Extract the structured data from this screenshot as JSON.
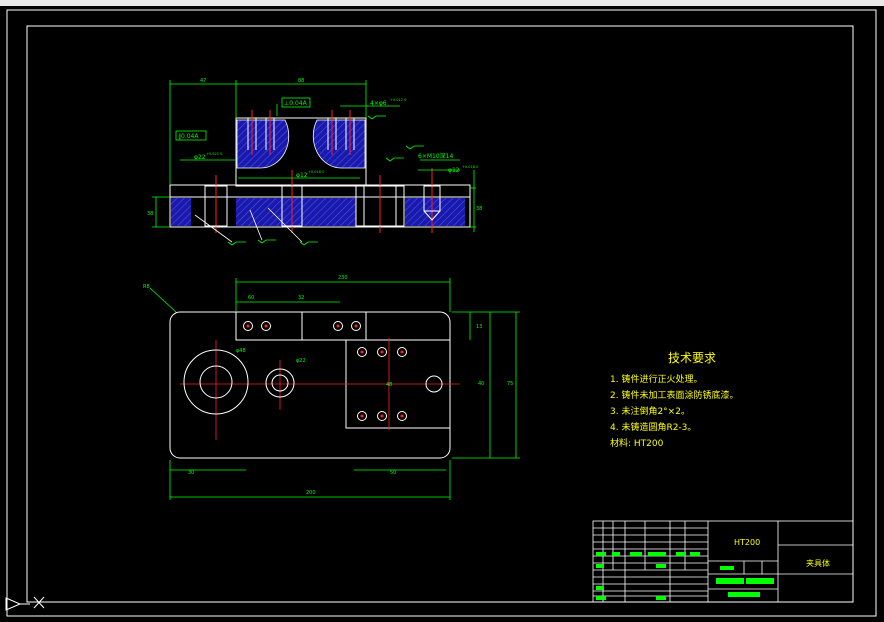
{
  "drawing": {
    "dims": {
      "top_47": "47",
      "top_88": "88",
      "right_height": "38",
      "left_height": "38",
      "fit_top": "4×φ6",
      "fit_top_tol": "+0.012 0",
      "fit_mid": "φ12",
      "fit_mid_tol": "+0.018 0",
      "thread": "6×M10深14",
      "fit_right": "φ12",
      "fit_right_tol": "+0.018 0",
      "fit_left": "φ22",
      "fit_left_tol": "+0.021 0",
      "tol_a": "⊥0.04A",
      "tol_b": "∥0.04A",
      "plan_230": "230",
      "plan_60": "60",
      "plan_32": "32",
      "plan_200": "200",
      "plan_30": "30",
      "plan_13": "13",
      "plan_40": "40",
      "plan_75": "75",
      "plan_48": "48",
      "plan_50": "50",
      "plan_phi48": "φ48",
      "plan_phi22": "φ22",
      "plan_r": "R8"
    }
  },
  "tech": {
    "title": "技术要求",
    "items": [
      "1. 铸件进行正火处理。",
      "2. 铸件未加工表面涂防锈底漆。",
      "3. 未注倒角2°×2。",
      "4. 未铸造圆角R2-3。",
      "材料: HT200"
    ]
  },
  "titleblock": {
    "material": "HT200",
    "part_name": "夹具体"
  },
  "statusbar": {
    "ucs": "ucs-icon"
  },
  "colors": {
    "cad_bg": "#000000",
    "line_white": "#ffffff",
    "dim_green": "#00ff00",
    "hatch_blue": "#2323c8",
    "center_red": "#ff2020",
    "tech_yellow": "#ffff00"
  }
}
